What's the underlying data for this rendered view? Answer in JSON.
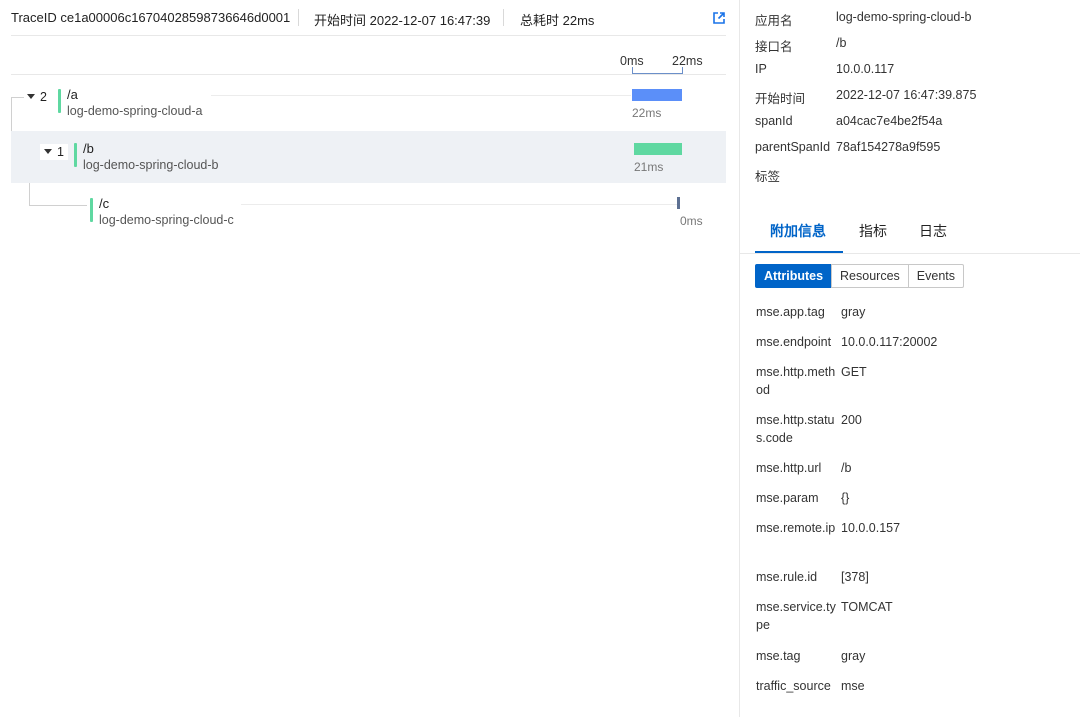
{
  "header": {
    "trace_id": "TraceID ce1a00006c16704028598736646d0001",
    "start_time": "开始时间 2022-12-07 16:47:39",
    "total_time": "总耗时 22ms",
    "external_link_icon": "external-link-icon"
  },
  "timeline": {
    "scale_start": "0ms",
    "scale_end": "22ms",
    "total_ms": 22
  },
  "spans": [
    {
      "count": "2",
      "name": "/a",
      "service": "log-demo-spring-cloud-a",
      "duration": "22ms",
      "duration_ms": 22,
      "bar_color": "#5b8ff9"
    },
    {
      "count": "1",
      "name": "/b",
      "service": "log-demo-spring-cloud-b",
      "duration": "21ms",
      "duration_ms": 21,
      "bar_color": "#5fd8a1"
    },
    {
      "count": "",
      "name": "/c",
      "service": "log-demo-spring-cloud-c",
      "duration": "0ms",
      "duration_ms": 0,
      "bar_color": "#5d7092"
    }
  ],
  "details": [
    {
      "key": "应用名",
      "value": "log-demo-spring-cloud-b"
    },
    {
      "key": "接口名",
      "value": "/b"
    },
    {
      "key": "IP",
      "value": "10.0.0.117"
    },
    {
      "key": "开始时间",
      "value": "2022-12-07 16:47:39.875"
    },
    {
      "key": "spanId",
      "value": "a04cac7e4be2f54a"
    },
    {
      "key": "parentSpanId",
      "value": "78af154278a9f595"
    },
    {
      "key": "标签",
      "value": ""
    }
  ],
  "tabs": [
    "附加信息",
    "指标",
    "日志"
  ],
  "segments": [
    "Attributes",
    "Resources",
    "Events"
  ],
  "attributes": [
    {
      "key": "mse.app.tag",
      "value": "gray"
    },
    {
      "key": "mse.endpoint",
      "value": "10.0.0.117:20002"
    },
    {
      "key": "mse.http.method",
      "value": "GET"
    },
    {
      "key": "mse.http.status.code",
      "value": "200"
    },
    {
      "key": "mse.http.url",
      "value": "/b"
    },
    {
      "key": "mse.param",
      "value": "{}"
    },
    {
      "key": "mse.remote.ip",
      "value": "10.0.0.157"
    },
    {
      "key": "mse.rule.id",
      "value": "[378]"
    },
    {
      "key": "mse.service.type",
      "value": "TOMCAT"
    },
    {
      "key": "mse.tag",
      "value": "gray"
    },
    {
      "key": "traffic_source",
      "value": "mse"
    }
  ],
  "accent_color": "#0064c8"
}
